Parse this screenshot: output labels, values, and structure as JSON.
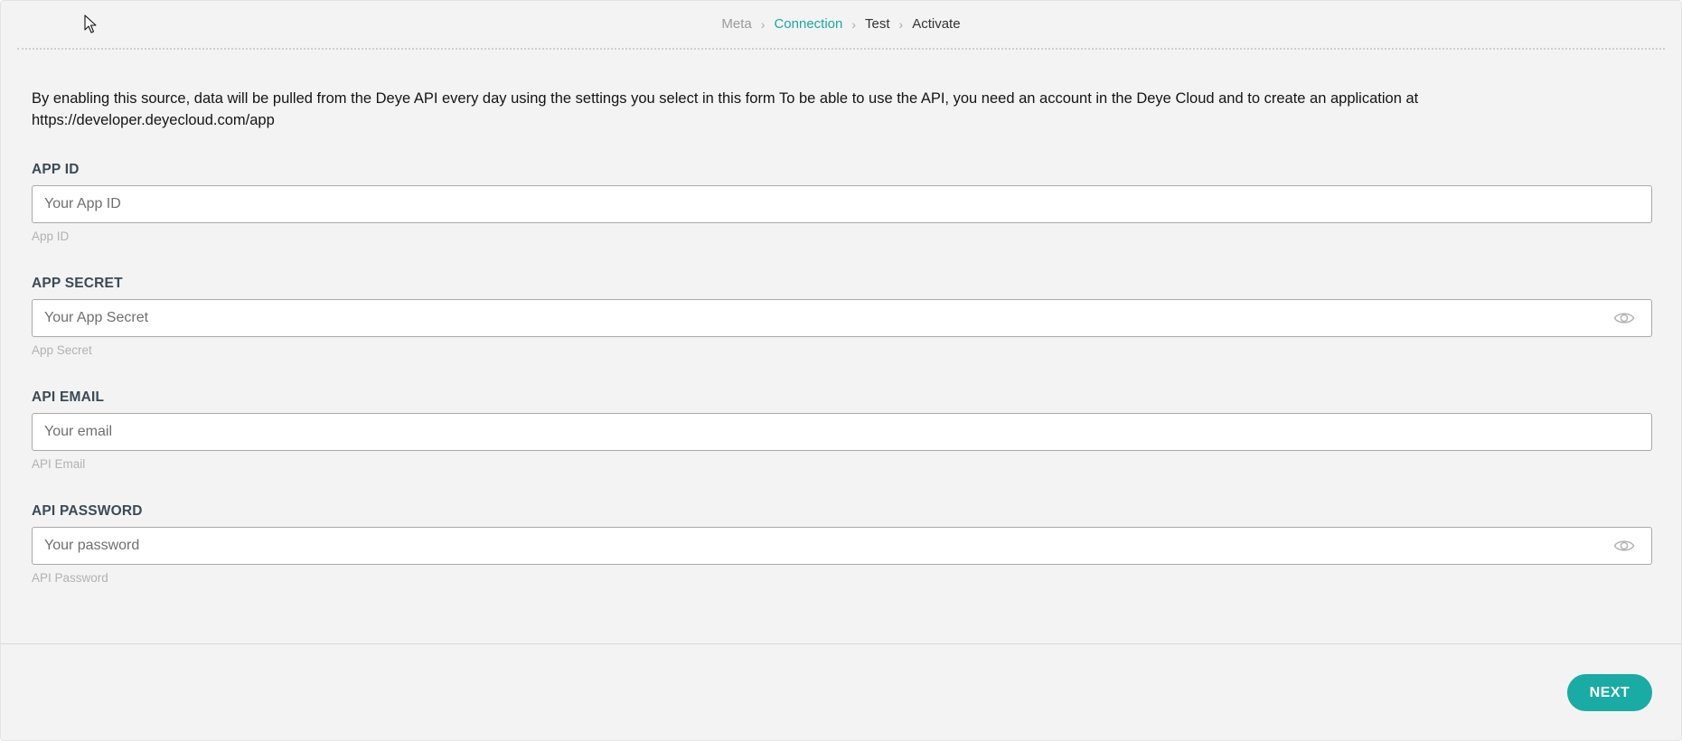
{
  "stepper": {
    "steps": [
      {
        "label": "Meta",
        "state": "done"
      },
      {
        "label": "Connection",
        "state": "active"
      },
      {
        "label": "Test",
        "state": "upcoming"
      },
      {
        "label": "Activate",
        "state": "upcoming"
      }
    ],
    "separator": "›"
  },
  "intro_text": "By enabling this source, data will be pulled from the Deye API every day using the settings you select in this form To be able to use the API, you need an account in the Deye Cloud and to create an application at https://developer.deyecloud.com/app",
  "fields": [
    {
      "label": "APP ID",
      "placeholder": "Your App ID",
      "value": "",
      "hint": "App ID",
      "type": "text",
      "has_eye_icon": false
    },
    {
      "label": "APP SECRET",
      "placeholder": "Your App Secret",
      "value": "",
      "hint": "App Secret",
      "type": "password",
      "has_eye_icon": true
    },
    {
      "label": "API EMAIL",
      "placeholder": "Your email",
      "value": "",
      "hint": "API Email",
      "type": "email",
      "has_eye_icon": false
    },
    {
      "label": "API PASSWORD",
      "placeholder": "Your password",
      "value": "",
      "hint": "API Password",
      "type": "password",
      "has_eye_icon": true
    }
  ],
  "footer": {
    "next_label": "NEXT"
  },
  "colors": {
    "accent": "#1aaba4",
    "active_step": "#1ba9a4",
    "background": "#f3f3f3"
  },
  "icons": {
    "cursor": "mouse-pointer-icon",
    "reveal": "eye-icon"
  }
}
